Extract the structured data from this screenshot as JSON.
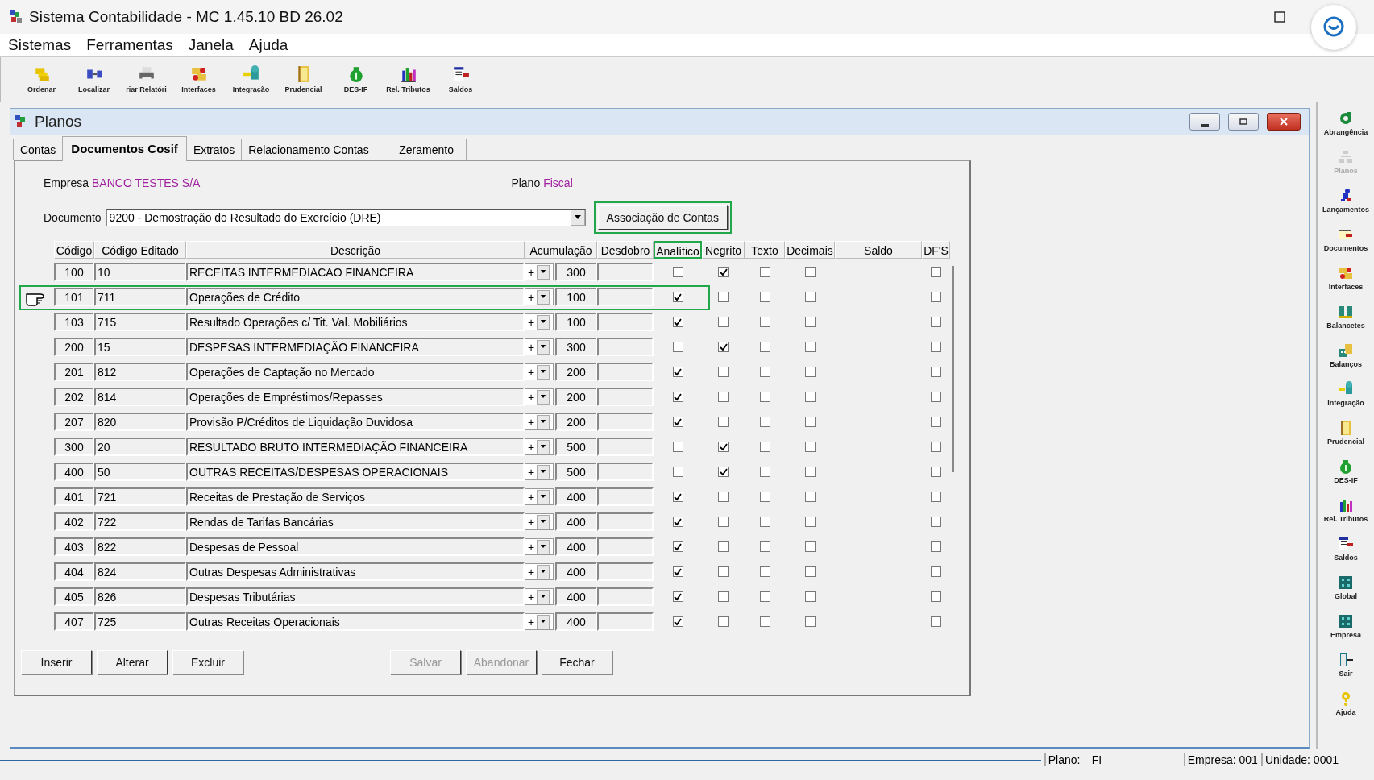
{
  "window": {
    "title": "Sistema Contabilidade -  MC 1.45.10 BD 26.02"
  },
  "menu": [
    "Sistemas",
    "Ferramentas",
    "Janela",
    "Ajuda"
  ],
  "toolbar": [
    {
      "label": "Ordenar"
    },
    {
      "label": "Localizar"
    },
    {
      "label": "riar Relatóri"
    },
    {
      "label": "Interfaces"
    },
    {
      "label": "Integração"
    },
    {
      "label": "Prudencial"
    },
    {
      "label": "DES-IF"
    },
    {
      "label": "Rel. Tributos"
    },
    {
      "label": "Saldos"
    }
  ],
  "child_window": {
    "title": "Planos"
  },
  "tabs": [
    {
      "label": "Contas",
      "selected": false
    },
    {
      "label": "Documentos Cosif",
      "selected": true
    },
    {
      "label": "Extratos",
      "selected": false
    },
    {
      "label": "Relacionamento Contas",
      "selected": false
    },
    {
      "label": "Zeramento",
      "selected": false
    }
  ],
  "empresa": {
    "label": "Empresa",
    "value": "BANCO TESTES S/A"
  },
  "plano": {
    "label": "Plano",
    "value": "Fiscal"
  },
  "documento": {
    "label": "Documento",
    "value": "9200 - Demostração do Resultado do Exercício (DRE)"
  },
  "association_button": {
    "label": "Associação de Contas",
    "highlighted": true
  },
  "table": {
    "columns": [
      {
        "label": "Código",
        "highlighted": false
      },
      {
        "label": "Código Editado",
        "highlighted": false
      },
      {
        "label": "Descrição",
        "highlighted": false
      },
      {
        "label": "Acumulação",
        "highlighted": false
      },
      {
        "label": "Desdobro",
        "highlighted": false
      },
      {
        "label": "Analítico",
        "highlighted": true
      },
      {
        "label": "Negrito",
        "highlighted": false
      },
      {
        "label": "Texto",
        "highlighted": false
      },
      {
        "label": "Decimais",
        "highlighted": false
      },
      {
        "label": "Saldo",
        "highlighted": false
      },
      {
        "label": "DF'S",
        "highlighted": false
      }
    ],
    "rows": [
      {
        "codigo": "100",
        "editado": "10",
        "descricao": "RECEITAS INTERMEDIACAO FINANCEIRA",
        "sinal": "+",
        "acumulacao": "300",
        "analitico": false,
        "negrito": true,
        "texto": false,
        "decimais": false,
        "dfs": false,
        "current": false
      },
      {
        "codigo": "101",
        "editado": "711",
        "descricao": "Operações de Crédito",
        "sinal": "+",
        "acumulacao": "100",
        "analitico": true,
        "negrito": false,
        "texto": false,
        "decimais": false,
        "dfs": false,
        "current": true
      },
      {
        "codigo": "103",
        "editado": "715",
        "descricao": "Resultado Operações c/ Tit. Val. Mobiliários",
        "sinal": "+",
        "acumulacao": "100",
        "analitico": true,
        "negrito": false,
        "texto": false,
        "decimais": false,
        "dfs": false,
        "current": false
      },
      {
        "codigo": "200",
        "editado": "15",
        "descricao": "DESPESAS INTERMEDIAÇÃO FINANCEIRA",
        "sinal": "+",
        "acumulacao": "300",
        "analitico": false,
        "negrito": true,
        "texto": false,
        "decimais": false,
        "dfs": false,
        "current": false
      },
      {
        "codigo": "201",
        "editado": "812",
        "descricao": "Operações de Captação no Mercado",
        "sinal": "+",
        "acumulacao": "200",
        "analitico": true,
        "negrito": false,
        "texto": false,
        "decimais": false,
        "dfs": false,
        "current": false
      },
      {
        "codigo": "202",
        "editado": "814",
        "descricao": "Operações de Empréstimos/Repasses",
        "sinal": "+",
        "acumulacao": "200",
        "analitico": true,
        "negrito": false,
        "texto": false,
        "decimais": false,
        "dfs": false,
        "current": false
      },
      {
        "codigo": "207",
        "editado": "820",
        "descricao": "Provisão P/Créditos de Liquidação Duvidosa",
        "sinal": "+",
        "acumulacao": "200",
        "analitico": true,
        "negrito": false,
        "texto": false,
        "decimais": false,
        "dfs": false,
        "current": false
      },
      {
        "codigo": "300",
        "editado": "20",
        "descricao": "RESULTADO BRUTO INTERMEDIAÇÃO FINANCEIRA",
        "sinal": "+",
        "acumulacao": "500",
        "analitico": false,
        "negrito": true,
        "texto": false,
        "decimais": false,
        "dfs": false,
        "current": false
      },
      {
        "codigo": "400",
        "editado": "50",
        "descricao": "OUTRAS RECEITAS/DESPESAS OPERACIONAIS",
        "sinal": "+",
        "acumulacao": "500",
        "analitico": false,
        "negrito": true,
        "texto": false,
        "decimais": false,
        "dfs": false,
        "current": false
      },
      {
        "codigo": "401",
        "editado": "721",
        "descricao": "Receitas de Prestação de Serviços",
        "sinal": "+",
        "acumulacao": "400",
        "analitico": true,
        "negrito": false,
        "texto": false,
        "decimais": false,
        "dfs": false,
        "current": false
      },
      {
        "codigo": "402",
        "editado": "722",
        "descricao": "Rendas de Tarifas Bancárias",
        "sinal": "+",
        "acumulacao": "400",
        "analitico": true,
        "negrito": false,
        "texto": false,
        "decimais": false,
        "dfs": false,
        "current": false
      },
      {
        "codigo": "403",
        "editado": "822",
        "descricao": "Despesas de Pessoal",
        "sinal": "+",
        "acumulacao": "400",
        "analitico": true,
        "negrito": false,
        "texto": false,
        "decimais": false,
        "dfs": false,
        "current": false
      },
      {
        "codigo": "404",
        "editado": "824",
        "descricao": "Outras Despesas Administrativas",
        "sinal": "+",
        "acumulacao": "400",
        "analitico": true,
        "negrito": false,
        "texto": false,
        "decimais": false,
        "dfs": false,
        "current": false
      },
      {
        "codigo": "405",
        "editado": "826",
        "descricao": "Despesas Tributárias",
        "sinal": "+",
        "acumulacao": "400",
        "analitico": true,
        "negrito": false,
        "texto": false,
        "decimais": false,
        "dfs": false,
        "current": false
      },
      {
        "codigo": "407",
        "editado": "725",
        "descricao": "Outras Receitas Operacionais",
        "sinal": "+",
        "acumulacao": "400",
        "analitico": true,
        "negrito": false,
        "texto": false,
        "decimais": false,
        "dfs": false,
        "current": false
      }
    ]
  },
  "buttons": [
    {
      "label": "Inserir",
      "disabled": false
    },
    {
      "label": "Alterar",
      "disabled": false
    },
    {
      "label": "Excluir",
      "disabled": false
    },
    {
      "label": "Salvar",
      "disabled": true
    },
    {
      "label": "Abandonar",
      "disabled": true
    },
    {
      "label": "Fechar",
      "disabled": false
    }
  ],
  "sidebar": [
    {
      "label": "Abrangência",
      "disabled": false
    },
    {
      "label": "Planos",
      "disabled": true
    },
    {
      "label": "Lançamentos",
      "disabled": false
    },
    {
      "label": "Documentos",
      "disabled": false
    },
    {
      "label": "Interfaces",
      "disabled": false
    },
    {
      "label": "Balancetes",
      "disabled": false
    },
    {
      "label": "Balanços",
      "disabled": false
    },
    {
      "label": "Integração",
      "disabled": false
    },
    {
      "label": "Prudencial",
      "disabled": false
    },
    {
      "label": "DES-IF",
      "disabled": false
    },
    {
      "label": "Rel. Tributos",
      "disabled": false
    },
    {
      "label": "Saldos",
      "disabled": false
    },
    {
      "label": "Global",
      "disabled": false
    },
    {
      "label": "Empresa",
      "disabled": false
    },
    {
      "label": "Sair",
      "disabled": false
    },
    {
      "label": "Ajuda",
      "disabled": false
    }
  ],
  "status_bar": {
    "plano_label": "Plano:",
    "plano_value": "FI",
    "empresa": "Empresa: 001",
    "unidade": "Unidade: 0001"
  }
}
